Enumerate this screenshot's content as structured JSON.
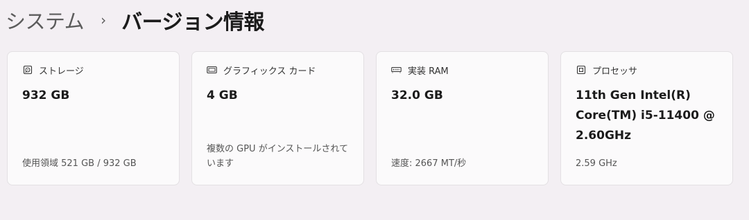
{
  "breadcrumb": {
    "parent": "システム",
    "separator": "›",
    "current": "バージョン情報"
  },
  "cards": [
    {
      "icon": "storage-icon",
      "title": "ストレージ",
      "value": "932 GB",
      "detail": "使用領域 521 GB / 932 GB"
    },
    {
      "icon": "graphics-card-icon",
      "title": "グラフィックス カード",
      "value": "4 GB",
      "detail": "複数の GPU がインストールされています"
    },
    {
      "icon": "memory-icon",
      "title": "実装 RAM",
      "value": "32.0 GB",
      "detail": "速度: 2667 MT/秒"
    },
    {
      "icon": "processor-icon",
      "title": "プロセッサ",
      "value": "11th Gen Intel(R) Core(TM) i5-11400 @ 2.60GHz",
      "detail": "2.59 GHz"
    }
  ]
}
